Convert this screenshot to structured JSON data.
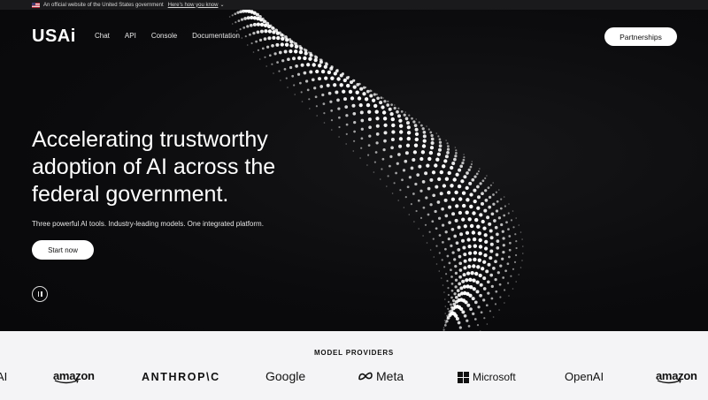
{
  "gov_banner": {
    "text": "An official website of the United States government",
    "link": "Here's how you know",
    "chevron": "⌄"
  },
  "nav": {
    "logo": "USAi",
    "links": [
      "Chat",
      "API",
      "Console",
      "Documentation"
    ],
    "cta": "Partnerships"
  },
  "hero": {
    "headline": "Accelerating trustworthy adoption of AI across the federal government.",
    "subhead": "Three powerful AI tools. Industry-leading models. One integrated platform.",
    "cta": "Start now"
  },
  "providers": {
    "title": "MODEL PROVIDERS",
    "logos": [
      "AI",
      "amazon",
      "ANTHROP\\C",
      "Google",
      "Meta",
      "Microsoft",
      "OpenAI",
      "amazon"
    ]
  },
  "colors": {
    "hero_bg": "#0b0b0d",
    "providers_bg": "#f4f4f6",
    "button_bg": "#ffffff",
    "text_light": "#ffffff",
    "text_dark": "#111111"
  },
  "icons": {
    "flag": "us-flag-icon",
    "pause": "pause-icon",
    "meta_logo": "meta-infinity-icon",
    "microsoft_logo": "microsoft-grid-icon"
  }
}
